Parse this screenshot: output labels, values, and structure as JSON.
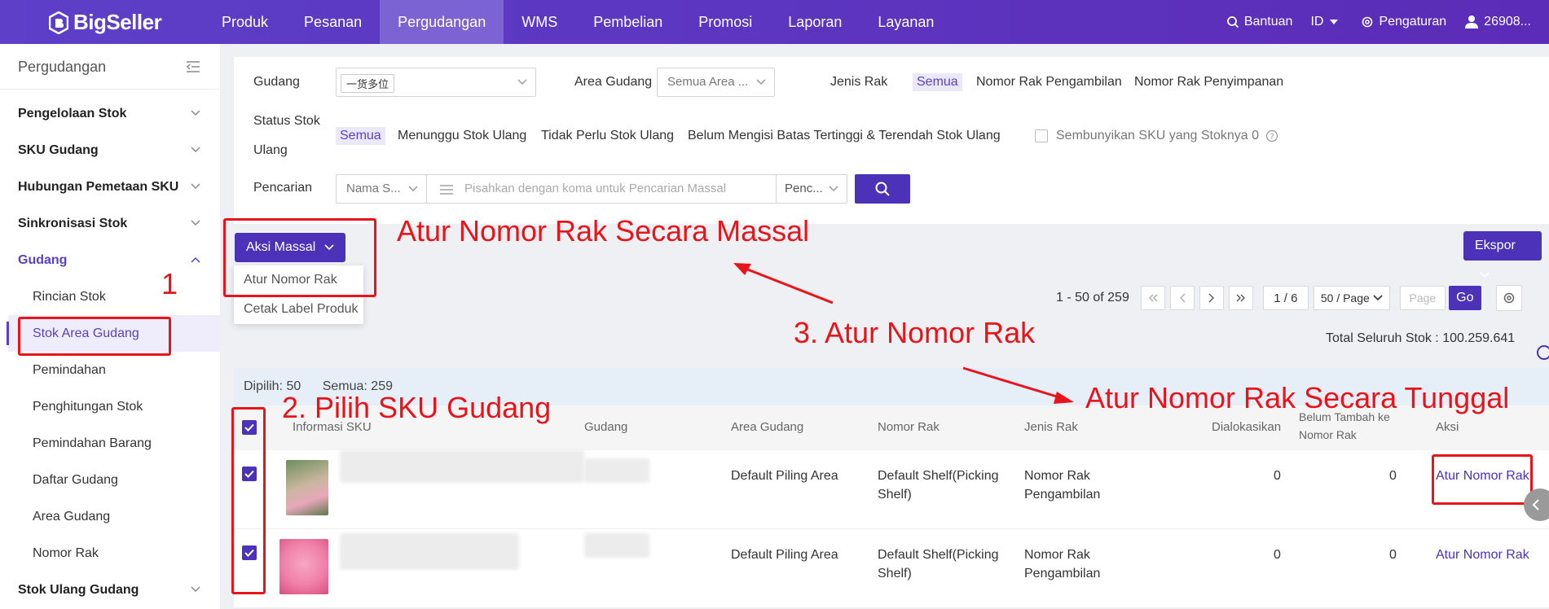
{
  "brand": {
    "name": "BigSeller",
    "accent": "#4b32b8",
    "topbar": "#5b2cb7",
    "annotation": "#e8141a"
  },
  "nav": [
    "Produk",
    "Pesanan",
    "Pergudangan",
    "WMS",
    "Pembelian",
    "Promosi",
    "Laporan",
    "Layanan"
  ],
  "nav_active": "Pergudangan",
  "top_right": {
    "help": "Bantuan",
    "lang": "ID",
    "settings": "Pengaturan",
    "user": "26908..."
  },
  "sidebar": {
    "title": "Pergudangan",
    "groups": [
      "Pengelolaan Stok",
      "SKU Gudang",
      "Hubungan Pemetaan SKU",
      "Sinkronisasi Stok",
      "Gudang"
    ],
    "sub_items": [
      "Rincian Stok",
      "Stok Area Gudang",
      "Pemindahan",
      "Penghitungan Stok",
      "Pemindahan Barang",
      "Daftar Gudang",
      "Area Gudang",
      "Nomor Rak"
    ],
    "last_group": "Stok Ulang Gudang"
  },
  "filters": {
    "warehouse_label": "Gudang",
    "warehouse_chip": "一货多位",
    "area_label": "Area Gudang",
    "area_value": "Semua Area ...",
    "rack_type_label": "Jenis Rak",
    "rack_type_options": [
      "Semua",
      "Nomor Rak Pengambilan",
      "Nomor Rak Penyimpanan"
    ],
    "restock_label_1": "Status Stok",
    "restock_label_2": "Ulang",
    "restock_options": [
      "Semua",
      "Menunggu Stok Ulang",
      "Tidak Perlu Stok Ulang",
      "Belum Mengisi Batas Tertinggi & Terendah Stok Ulang"
    ],
    "hide_zero_label": "Sembunyikan SKU yang Stoknya 0",
    "search_label": "Pencarian",
    "search_field": "Nama S...",
    "search_placeholder": "Pisahkan dengan koma untuk Pencarian Massal",
    "search_mode": "Penc..."
  },
  "toolbar": {
    "bulk_action": "Aksi Massal",
    "export": "Ekspor",
    "dropdown": [
      "Atur Nomor Rak",
      "Cetak Label Produk"
    ]
  },
  "pagination": {
    "range": "1 - 50 of 259",
    "page": "1 / 6",
    "per_page": "50 / Page",
    "page_placeholder": "Page",
    "go": "Go"
  },
  "total_stock": "Total Seluruh Stok : 100.259.641",
  "selection": {
    "selected": "Dipilih: 50",
    "all": "Semua: 259"
  },
  "table": {
    "headers": [
      "Informasi SKU",
      "Gudang",
      "Area Gudang",
      "Nomor Rak",
      "Jenis Rak",
      "Dialokasikan",
      "Belum Tambah ke",
      "Nomor Rak",
      "Aksi"
    ],
    "rows": [
      {
        "area": "Default Piling Area",
        "rack1": "Default Shelf(Picking",
        "rack2": "Shelf)",
        "type1": "Nomor Rak",
        "type2": "Pengambilan",
        "allocated": "0",
        "not_added": "0",
        "action": "Atur Nomor Rak"
      },
      {
        "area": "Default Piling Area",
        "rack1": "Default Shelf(Picking",
        "rack2": "Shelf)",
        "type1": "Nomor Rak",
        "type2": "Pengambilan",
        "allocated": "0",
        "not_added": "0",
        "action": "Atur Nomor Rak"
      }
    ]
  },
  "annotations": {
    "a1": "1",
    "bulk": "Atur Nomor Rak Secara Massal",
    "step3": "3. Atur Nomor Rak",
    "single": "Atur Nomor Rak Secara Tunggal",
    "step2": "2. Pilih SKU Gudang"
  }
}
